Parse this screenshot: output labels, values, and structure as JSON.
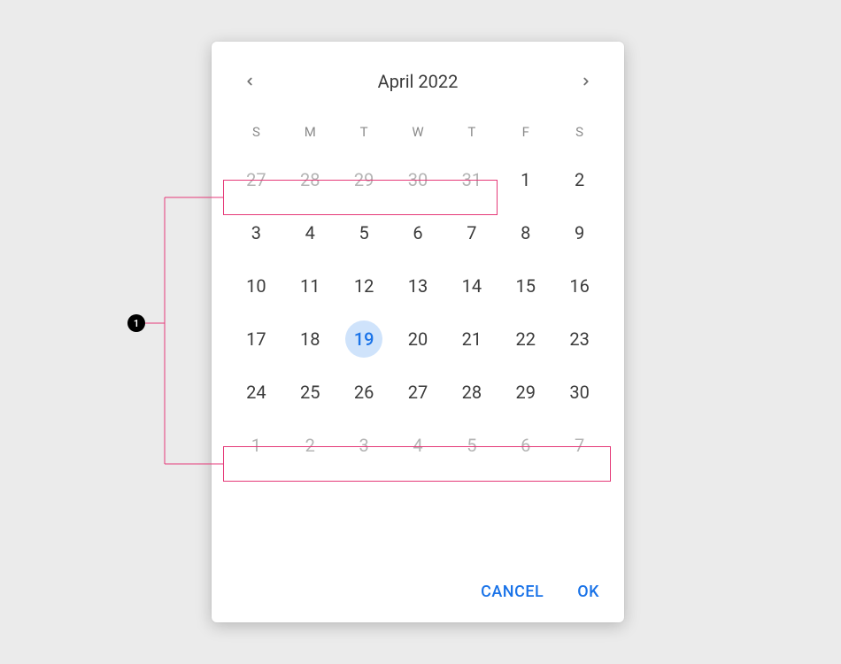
{
  "annotation": {
    "badge": "1"
  },
  "calendar": {
    "month_label": "April 2022",
    "weekdays": [
      "S",
      "M",
      "T",
      "W",
      "T",
      "F",
      "S"
    ],
    "selected_day": 19,
    "weeks": [
      [
        {
          "d": 27,
          "muted": true
        },
        {
          "d": 28,
          "muted": true
        },
        {
          "d": 29,
          "muted": true
        },
        {
          "d": 30,
          "muted": true
        },
        {
          "d": 31,
          "muted": true
        },
        {
          "d": 1,
          "muted": false
        },
        {
          "d": 2,
          "muted": false
        }
      ],
      [
        {
          "d": 3,
          "muted": false
        },
        {
          "d": 4,
          "muted": false
        },
        {
          "d": 5,
          "muted": false
        },
        {
          "d": 6,
          "muted": false
        },
        {
          "d": 7,
          "muted": false
        },
        {
          "d": 8,
          "muted": false
        },
        {
          "d": 9,
          "muted": false
        }
      ],
      [
        {
          "d": 10,
          "muted": false
        },
        {
          "d": 11,
          "muted": false
        },
        {
          "d": 12,
          "muted": false
        },
        {
          "d": 13,
          "muted": false
        },
        {
          "d": 14,
          "muted": false
        },
        {
          "d": 15,
          "muted": false
        },
        {
          "d": 16,
          "muted": false
        }
      ],
      [
        {
          "d": 17,
          "muted": false
        },
        {
          "d": 18,
          "muted": false
        },
        {
          "d": 19,
          "muted": false,
          "selected": true
        },
        {
          "d": 20,
          "muted": false
        },
        {
          "d": 21,
          "muted": false
        },
        {
          "d": 22,
          "muted": false
        },
        {
          "d": 23,
          "muted": false
        }
      ],
      [
        {
          "d": 24,
          "muted": false
        },
        {
          "d": 25,
          "muted": false
        },
        {
          "d": 26,
          "muted": false
        },
        {
          "d": 27,
          "muted": false
        },
        {
          "d": 28,
          "muted": false
        },
        {
          "d": 29,
          "muted": false
        },
        {
          "d": 30,
          "muted": false
        }
      ],
      [
        {
          "d": 1,
          "muted": true
        },
        {
          "d": 2,
          "muted": true
        },
        {
          "d": 3,
          "muted": true
        },
        {
          "d": 4,
          "muted": true
        },
        {
          "d": 5,
          "muted": true
        },
        {
          "d": 6,
          "muted": true
        },
        {
          "d": 7,
          "muted": true
        }
      ]
    ],
    "actions": {
      "cancel": "CANCEL",
      "ok": "OK"
    }
  }
}
